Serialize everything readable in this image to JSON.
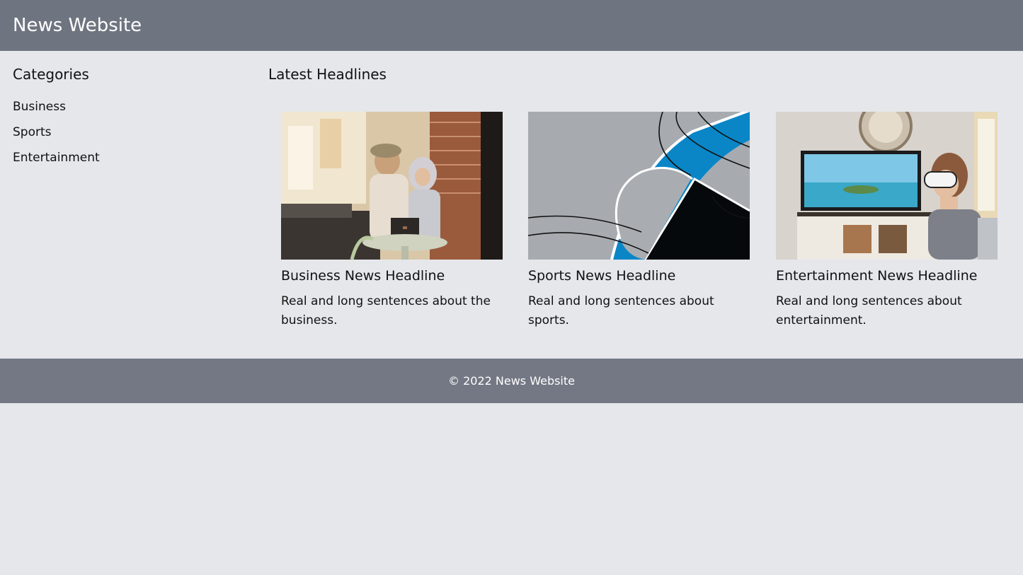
{
  "header": {
    "site_title": "News Website"
  },
  "sidebar": {
    "heading": "Categories",
    "categories": [
      {
        "label": "Business"
      },
      {
        "label": "Sports"
      },
      {
        "label": "Entertainment"
      }
    ]
  },
  "main": {
    "heading": "Latest Headlines",
    "articles": [
      {
        "headline": "Business News Headline",
        "summary": "Real and long sentences about the business.",
        "image": "photo of two women looking at a laptop in a café"
      },
      {
        "headline": "Sports News Headline",
        "summary": "Real and long sentences about sports.",
        "image": "close-up of blue and white court markings"
      },
      {
        "headline": "Entertainment News Headline",
        "summary": "Real and long sentences about entertainment.",
        "image": "child wearing a VR headset in front of a TV"
      }
    ]
  },
  "footer": {
    "copyright": "© 2022 News Website"
  },
  "colors": {
    "page_background": "#e5e7eb",
    "header_background": "#6f7580",
    "footer_background": "#737884",
    "header_text": "#ffffff",
    "body_text": "#111111"
  }
}
